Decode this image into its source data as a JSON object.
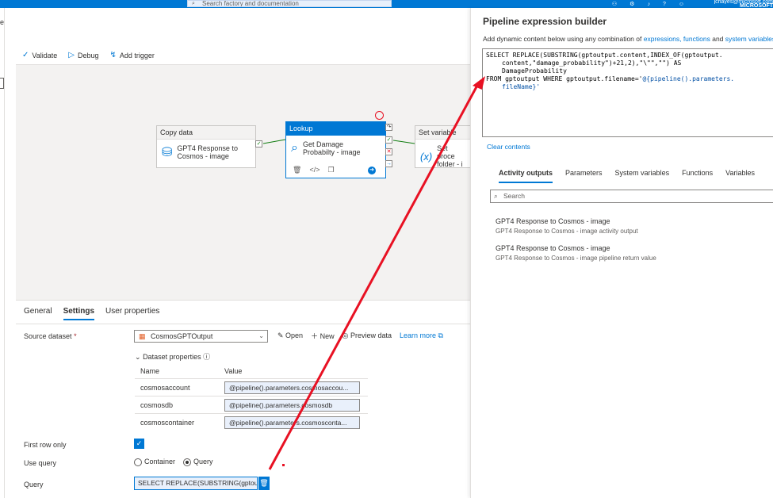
{
  "topbar": {
    "search_placeholder": "Search factory and documentation",
    "account": "jchayes@microsoft.com",
    "tenant": "MICROSOFT"
  },
  "left_edge": {
    "letter": "e"
  },
  "toolbar": {
    "validate": "Validate",
    "debug": "Debug",
    "add_trigger": "Add trigger"
  },
  "activities": {
    "copy": {
      "type": "Copy data",
      "name_line1": "GPT4 Response to",
      "name_line2": "Cosmos - image"
    },
    "lookup": {
      "type": "Lookup",
      "name_line1": "Get Damage",
      "name_line2": "Probabilty - image"
    },
    "set": {
      "type": "Set variable",
      "name_line1": "Set proce",
      "name_line2": "folder - i"
    }
  },
  "props": {
    "tabs": [
      "General",
      "Settings",
      "User properties"
    ],
    "source_dataset_label": "Source dataset",
    "source_dataset_value": "CosmosGPTOutput",
    "open": "Open",
    "new": "New",
    "preview": "Preview data",
    "learn_more": "Learn more",
    "dataset_properties": "Dataset properties",
    "col_name": "Name",
    "col_value": "Value",
    "rows": [
      {
        "name": "cosmosaccount",
        "value": "@pipeline().parameters.cosmosaccou..."
      },
      {
        "name": "cosmosdb",
        "value": "@pipeline().parameters.cosmosdb"
      },
      {
        "name": "cosmoscontainer",
        "value": "@pipeline().parameters.cosmosconta..."
      }
    ],
    "first_row_only": "First row only",
    "use_query": "Use query",
    "opt_container": "Container",
    "opt_query": "Query",
    "query_label": "Query",
    "query_value": "SELECT REPLACE(SUBSTRING(gptout..."
  },
  "panel": {
    "title": "Pipeline expression builder",
    "desc_prefix": "Add dynamic content below using any combination of",
    "link_expressions": "expressions,",
    "link_functions": "functions",
    "desc_and": "and",
    "link_system": "system variables.",
    "editor_lines": [
      "SELECT REPLACE(SUBSTRING(gptoutput.content,INDEX_OF(gptoutput.",
      "content,\"damage_probability\")+21,2),\"\\\"\",\"\") AS",
      "DamageProbability",
      "FROM gptoutput WHERE gptoutput.filename='",
      "@{pipeline().parameters.",
      "fileName}'"
    ],
    "clear": "Clear contents",
    "tabs": [
      "Activity outputs",
      "Parameters",
      "System variables",
      "Functions",
      "Variables"
    ],
    "search_placeholder": "Search",
    "outputs": [
      {
        "title": "GPT4 Response to Cosmos - image",
        "sub": "GPT4 Response to Cosmos - image activity output"
      },
      {
        "title": "GPT4 Response to Cosmos - image",
        "sub": "GPT4 Response to Cosmos - image pipeline return value"
      }
    ]
  },
  "colors": {
    "accent": "#0078d4",
    "arrow": "#e81123"
  }
}
